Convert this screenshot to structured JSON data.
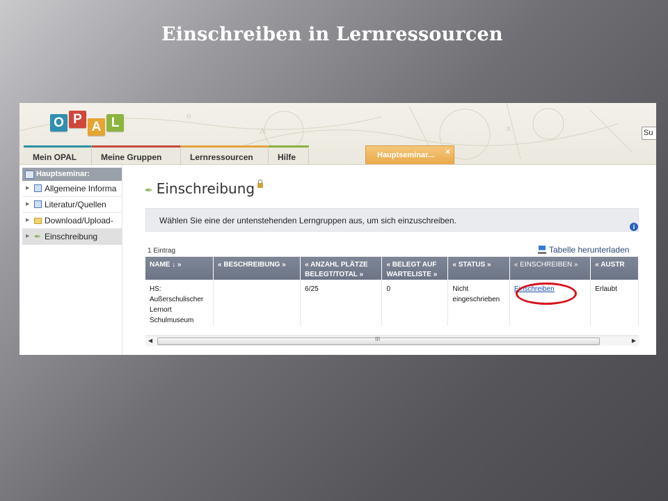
{
  "slide": {
    "title": "Einschreiben in Lernressourcen"
  },
  "header": {
    "logo_letters": [
      "O",
      "P",
      "A",
      "L"
    ],
    "logo_colors": [
      "#2f8fb0",
      "#d0473a",
      "#e6a431",
      "#8cb43f"
    ],
    "search_partial": "Su",
    "tabs": [
      "Mein OPAL",
      "Meine Gruppen",
      "Lernressourcen",
      "Hilfe"
    ],
    "active_tab": {
      "label": "Hauptseminar...",
      "close_symbol": "×"
    }
  },
  "sidebar": {
    "title": "Hauptseminar:",
    "items": [
      {
        "label": "Allgemeine Informa",
        "icon": "document-icon"
      },
      {
        "label": "Literatur/Quellen",
        "icon": "document-icon"
      },
      {
        "label": "Download/Upload-",
        "icon": "folder-icon"
      },
      {
        "label": "Einschreibung",
        "icon": "feather-icon",
        "active": true
      }
    ]
  },
  "content": {
    "title": "Einschreibung",
    "info_text": "Wählen Sie eine der untenstehenden Lerngruppen aus, um sich einzuschreiben.",
    "count": "1 Eintrag",
    "download_label": "Tabelle herunterladen",
    "table": {
      "headers": [
        "NAME ↓ »",
        "« BESCHREIBUNG »",
        "« ANZAHL PLÄTZE BELEGT/TOTAL »",
        "« BELEGT AUF WARTELISTE »",
        "« STATUS »",
        "« EINSCHREIBEN »",
        "« AUSTR"
      ],
      "row": {
        "name": "HS: Außerschulischer Lernort Schulmuseum",
        "beschreibung": "",
        "plaetze": "6/25",
        "warteliste": "0",
        "status": "Nicht eingeschrieben",
        "einschreiben_link": "Einschreiben",
        "austritt": "Erlaubt"
      }
    },
    "scroll_grip": "III"
  },
  "annotation": {
    "circle_color": "#d5121b"
  }
}
